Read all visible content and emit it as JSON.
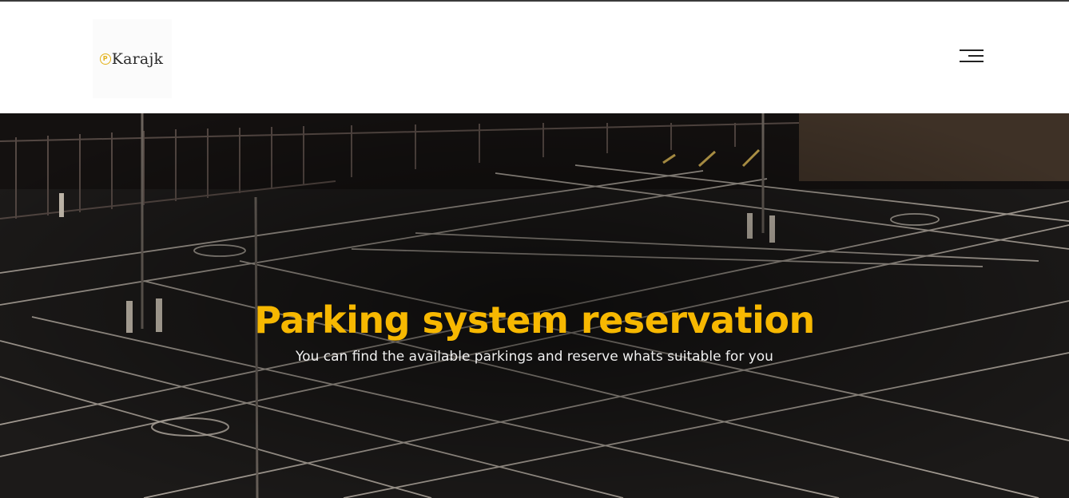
{
  "header": {
    "logo": {
      "icon_letter": "P",
      "text": "Karajk"
    },
    "menu_icon": "hamburger-menu-icon"
  },
  "hero": {
    "title": "Parking system reservation",
    "subtitle": "You can find the available parkings and reserve whats suitable for you",
    "background_image": "night-parking-lot-photo"
  },
  "colors": {
    "accent": "#f7b801",
    "header_bg": "#ffffff",
    "hero_text": "#f1f1f1",
    "logo_accent": "#e3b21a"
  }
}
